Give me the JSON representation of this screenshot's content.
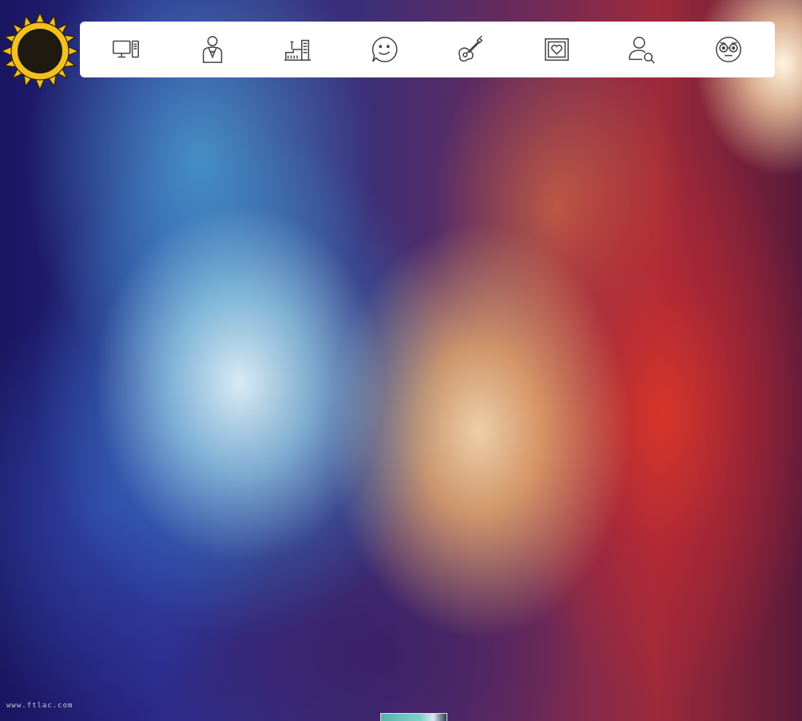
{
  "logo": {
    "icon": "sun-moon-icon",
    "color": "#f2c020"
  },
  "nav": {
    "icon_color": "#444444",
    "items": [
      {
        "icon": "desktop-computer-icon"
      },
      {
        "icon": "businessman-icon"
      },
      {
        "icon": "factory-building-icon"
      },
      {
        "icon": "chat-smiley-icon"
      },
      {
        "icon": "guitar-icon"
      },
      {
        "icon": "heart-frame-icon"
      },
      {
        "icon": "user-search-icon"
      },
      {
        "icon": "nerd-face-icon"
      }
    ]
  },
  "watermark": {
    "text": "www.ftlac.com"
  }
}
